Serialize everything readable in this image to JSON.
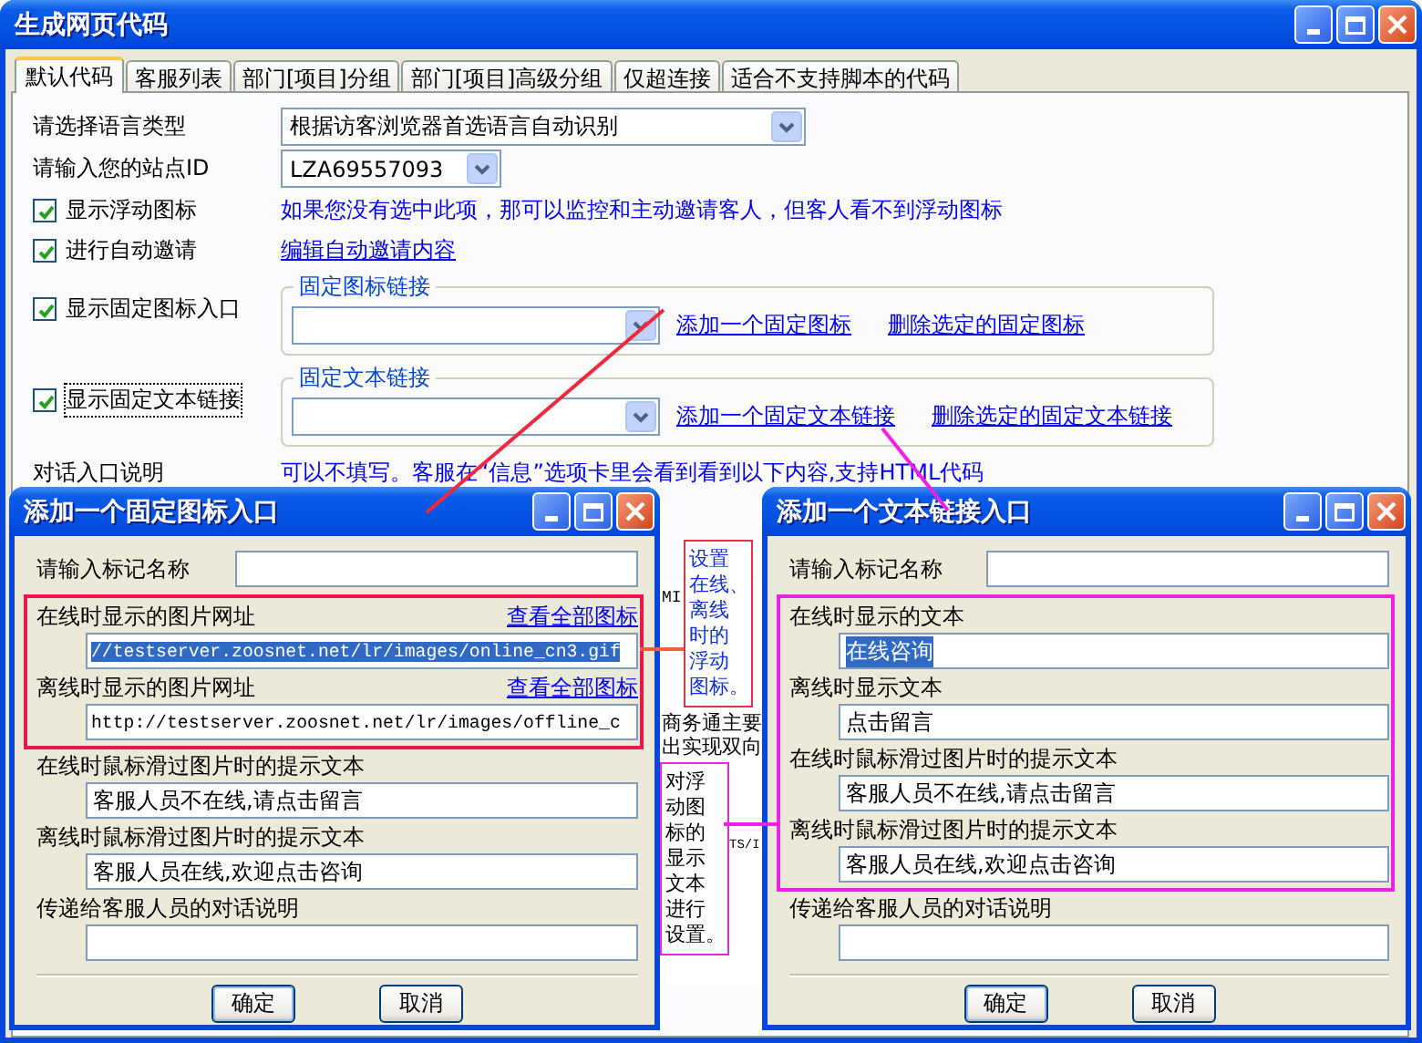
{
  "window": {
    "title": "生成网页代码"
  },
  "tabs": [
    {
      "label": "默认代码",
      "selected": true
    },
    {
      "label": "客服列表",
      "selected": false
    },
    {
      "label": "部门[项目]分组",
      "selected": false
    },
    {
      "label": "部门[项目]高级分组",
      "selected": false
    },
    {
      "label": "仅超连接",
      "selected": false
    },
    {
      "label": "适合不支持脚本的代码",
      "selected": false
    }
  ],
  "form": {
    "language": {
      "label": "请选择语言类型",
      "value": "根据访客浏览器首选语言自动识别"
    },
    "site_id": {
      "label": "请输入您的站点ID",
      "value": "LZA69557093"
    },
    "options": [
      {
        "label": "显示浮动图标",
        "checked": true,
        "note": "如果您没有选中此项，那可以监控和主动邀请客人，但客人看不到浮动图标"
      },
      {
        "label": "进行自动邀请",
        "checked": true,
        "link": "编辑自动邀请内容"
      }
    ],
    "groups": [
      {
        "label": "显示固定图标入口",
        "checked": true,
        "focused": false,
        "legend": "固定图标链接",
        "add_link": "添加一个固定图标",
        "delete_link": "删除选定的固定图标"
      },
      {
        "label": "显示固定文本链接",
        "checked": true,
        "focused": true,
        "legend": "固定文本链接",
        "add_link": "添加一个固定文本链接",
        "delete_link": "删除选定的固定文本链接"
      }
    ],
    "dialog_note": {
      "label": "对话入口说明",
      "hint": "可以不填写。客服在“信息”选项卡里会看到看到以下内容,支持HTML代码"
    }
  },
  "background_text": [
    "MI",
    "商务通主要",
    "出实现双向",
    "TS/I"
  ],
  "dialogs": [
    {
      "title": "添加一个固定图标入口",
      "name_label": "请输入标记名称",
      "fields": [
        {
          "label": "在线时显示的图片网址",
          "link": "查看全部图标",
          "value": "//testserver.zoosnet.net/lr/images/online_cn3.gif",
          "framed": true,
          "text_selected": true
        },
        {
          "label": "离线时显示的图片网址",
          "link": "查看全部图标",
          "value": "http://testserver.zoosnet.net/lr/images/offline_c",
          "framed": true,
          "text_selected": false
        },
        {
          "label": "在线时鼠标滑过图片时的提示文本",
          "value": "客服人员不在线,请点击留言",
          "framed": false,
          "text_selected": false
        },
        {
          "label": "离线时鼠标滑过图片时的提示文本",
          "value": "客服人员在线,欢迎点击咨询",
          "framed": false,
          "text_selected": false
        },
        {
          "label": "传递给客服人员的对话说明",
          "framed": false
        }
      ],
      "buttons": [
        "确定",
        "取消"
      ]
    },
    {
      "title": "添加一个文本链接入口",
      "name_label": "请输入标记名称",
      "fields": [
        {
          "label": "在线时显示的文本",
          "value": "在线咨询",
          "framed": true,
          "text_selected": true
        },
        {
          "label": "离线时显示文本",
          "value": "点击留言",
          "framed": true,
          "text_selected": false
        },
        {
          "label": "在线时鼠标滑过图片时的提示文本",
          "value": "客服人员不在线,请点击留言",
          "framed": true,
          "text_selected": false
        },
        {
          "label": "离线时鼠标滑过图片时的提示文本",
          "value": "客服人员在线,欢迎点击咨询",
          "framed": true,
          "text_selected": false
        },
        {
          "label": "传递给客服人员的对话说明",
          "framed": false
        }
      ],
      "buttons": [
        "确定",
        "取消"
      ]
    }
  ],
  "callouts": [
    {
      "kind": "icon-note",
      "text": "设置在线、离线时的浮动图标。",
      "color": "#e8304a"
    },
    {
      "kind": "text-note",
      "text": "对浮动图标的显示文本进行设置。",
      "color": "#f020e8"
    }
  ]
}
